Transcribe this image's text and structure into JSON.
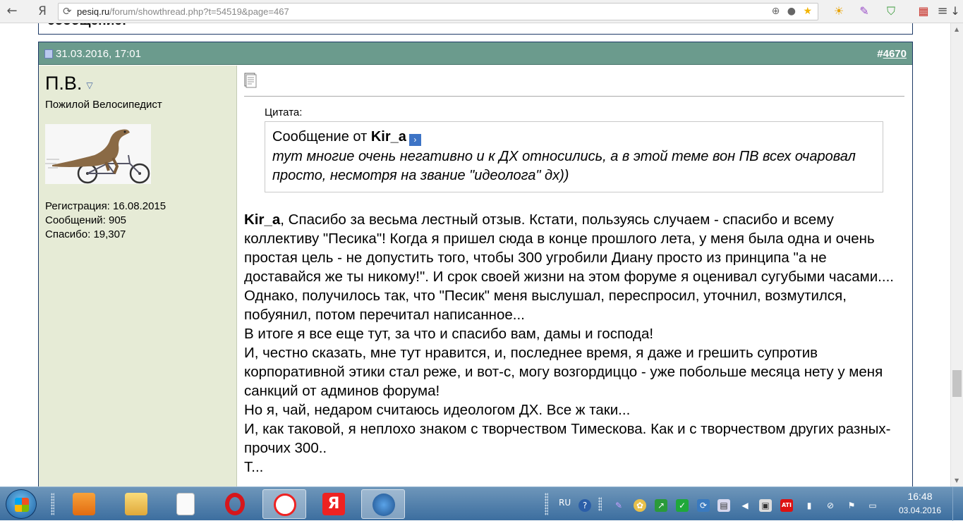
{
  "browser": {
    "back_icon": "←",
    "yandex_glyph": "Я",
    "url_host": "pesiq.ru",
    "url_path": "/forum/showthread.php?t=54519&page=467",
    "download_icon": "↓"
  },
  "prev_post": {
    "cut_text": "сообщение:"
  },
  "post": {
    "date": "31.03.2016, 17:01",
    "number_prefix": "#",
    "number": "4670",
    "username": "П.В.",
    "usertitle": "Пожилой Велосипедист",
    "stats": [
      "Регистрация: 16.08.2015",
      "Сообщений: 905",
      "Спасибо: 19,307"
    ],
    "quote_label": "Цитата:",
    "quote_author_prefix": "Сообщение от",
    "quote_author": "Kir_a",
    "quote_text": "тут многие очень негативно и к ДХ относились, а в этой теме вон ПВ всех очаровал просто, несмотря на звание \"идеолога\" дх))",
    "message_addressee": "Kir_a",
    "message_first": ", Спасибо за весьма лестный отзыв. Кстати, пользуясь случаем - спасибо и всему коллективу \"Песика\"! Когда я пришел сюда в конце прошлого лета, у меня была одна и очень простая цель - не допустить того, чтобы 300 угробили Диану просто из принципа \"а не доставайся же ты никому!\". И срок своей жизни на этом форуме я оценивал сугубыми часами....",
    "message_lines": [
      "Однако, получилось так, что \"Песик\" меня выслушал, переспросил, уточнил, возмутился, побуянил, потом перечитал написанное...",
      "В итоге я все еще тут, за что и спасибо вам, дамы и господа!",
      "И, честно сказать, мне тут нравится, и, последнее время, я даже и грешить супротив корпоративной этики стал реже, и вот-с, могу возгордиццо - уже побольше месяца нету у меня санкций от админов форума!",
      "Но я, чай, недаром считаюсь идеологом ДХ. Все ж таки...",
      "И, как таковой, я неплохо знаком с творчеством Тимескова. Как и с творчеством других разных-прочих 300..",
      "Т..."
    ]
  },
  "taskbar": {
    "language": "RU",
    "time": "16:48",
    "date": "03.04.2016"
  },
  "colors": {
    "post_header": "#6b9b8d",
    "userinfo_bg": "#e6ebd6",
    "border": "#1d3966"
  }
}
